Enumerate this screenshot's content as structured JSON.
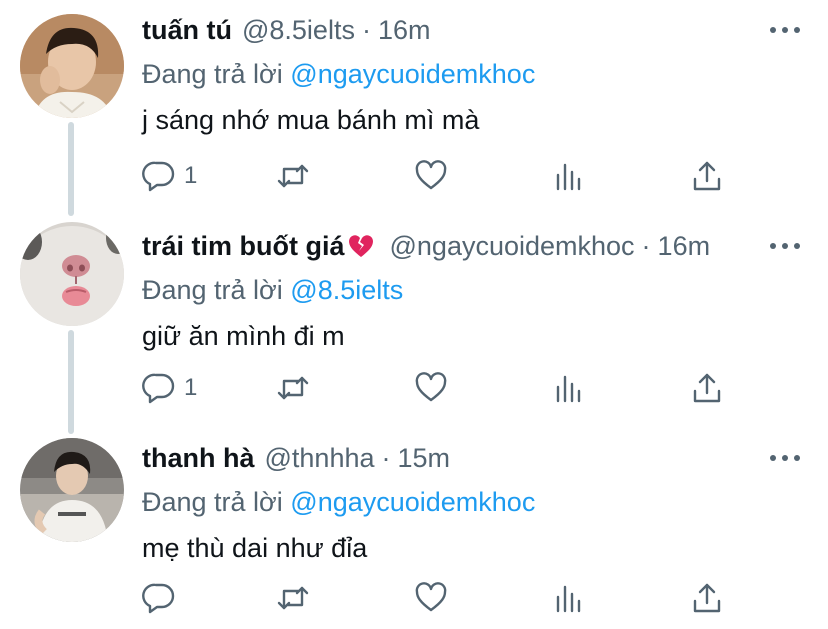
{
  "tweets": [
    {
      "name": "tuấn tú",
      "handle": "@8.5ielts",
      "separator": "·",
      "time": "16m",
      "replying_prefix": "Đang trả lời",
      "replying_to": "@ngaycuoidemkhoc",
      "text": "j sáng nhớ mua bánh mì mà",
      "reply_count": "1",
      "emoji": ""
    },
    {
      "name": "trái tim buốt giá",
      "handle": "@ngaycuoidemkhoc",
      "separator": "·",
      "time": "16m",
      "replying_prefix": "Đang trả lời",
      "replying_to": "@8.5ielts",
      "text": "giữ ăn mình đi m",
      "reply_count": "1",
      "emoji": "broken-heart-icon"
    },
    {
      "name": "thanh hà",
      "handle": "@thnhha",
      "separator": "·",
      "time": "15m",
      "replying_prefix": "Đang trả lời",
      "replying_to": "@ngaycuoidemkhoc",
      "text": "mẹ thù dai như đỉa",
      "reply_count": "",
      "emoji": ""
    }
  ],
  "icons": {
    "reply": "reply-icon",
    "retweet": "retweet-icon",
    "like": "heart-icon",
    "analytics": "analytics-icon",
    "share": "share-icon",
    "more": "more-icon"
  },
  "colors": {
    "text": "#0f1419",
    "secondary": "#536471",
    "link": "#1d9bf0",
    "thread_line": "#cfd9de",
    "broken_heart": "#e0245e"
  }
}
